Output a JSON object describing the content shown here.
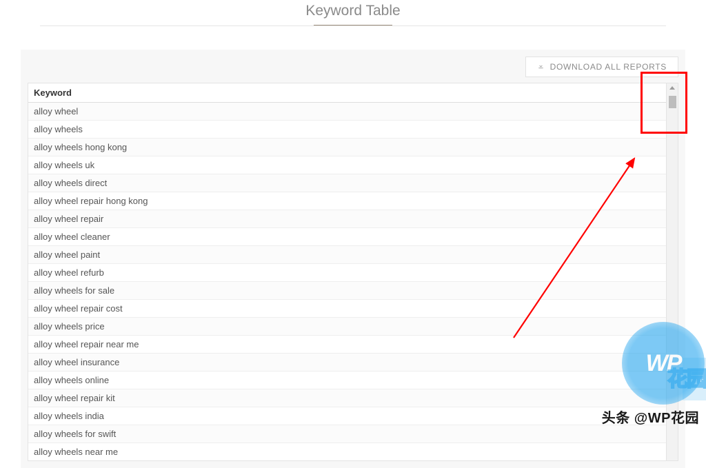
{
  "header": {
    "title": "Keyword Table"
  },
  "toolbar": {
    "download_label": "DOWNLOAD ALL REPORTS"
  },
  "table": {
    "column_header": "Keyword",
    "rows": [
      "alloy wheel",
      "alloy wheels",
      "alloy wheels hong kong",
      "alloy wheels uk",
      "alloy wheels direct",
      "alloy wheel repair hong kong",
      "alloy wheel repair",
      "alloy wheel cleaner",
      "alloy wheel paint",
      "alloy wheel refurb",
      "alloy wheels for sale",
      "alloy wheel repair cost",
      "alloy wheels price",
      "alloy wheel repair near me",
      "alloy wheel insurance",
      "alloy wheels online",
      "alloy wheel repair kit",
      "alloy wheels india",
      "alloy wheels for swift",
      "alloy wheels near me"
    ]
  },
  "watermark": {
    "badge": "WP",
    "hanzi": "花园",
    "attribution": "头条 @WP花园"
  }
}
